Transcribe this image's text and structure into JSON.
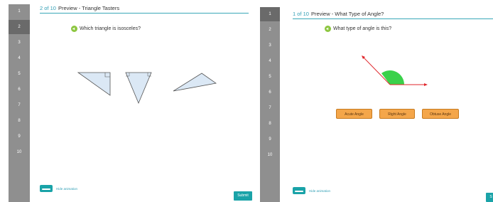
{
  "left_panel": {
    "question_numbers": [
      "1",
      "2",
      "3",
      "4",
      "5",
      "6",
      "7",
      "8",
      "9",
      "10"
    ],
    "active_question": "2",
    "header": {
      "count": "2 of 10",
      "title": "Preview - Triangle Tasters"
    },
    "question_text": "Which triangle is isosceles?",
    "hide_animation_label": "Hide animation",
    "submit_label": "Submit",
    "shape_fill": "#dbe8f5",
    "shape_stroke": "#555555"
  },
  "right_panel": {
    "question_numbers": [
      "1",
      "2",
      "3",
      "4",
      "5",
      "6",
      "7",
      "8",
      "9",
      "10"
    ],
    "active_question": "1",
    "header": {
      "count": "1 of 10",
      "title": "Preview - What Type of Angle?"
    },
    "question_text": "What type of angle is this?",
    "answers": [
      "Acute Angle",
      "Right Angle",
      "Obtuse Angle"
    ],
    "hide_animation_label": "Hide animation",
    "submit_label": "S",
    "angle_arm_color": "#e0262b",
    "angle_arc_color": "#3ad14a"
  },
  "colors": {
    "accent_teal": "#1aa3a8",
    "header_link": "#2f9eb4",
    "answer_orange": "#f4a64a",
    "sidebar_gray": "#8f8f8f"
  }
}
